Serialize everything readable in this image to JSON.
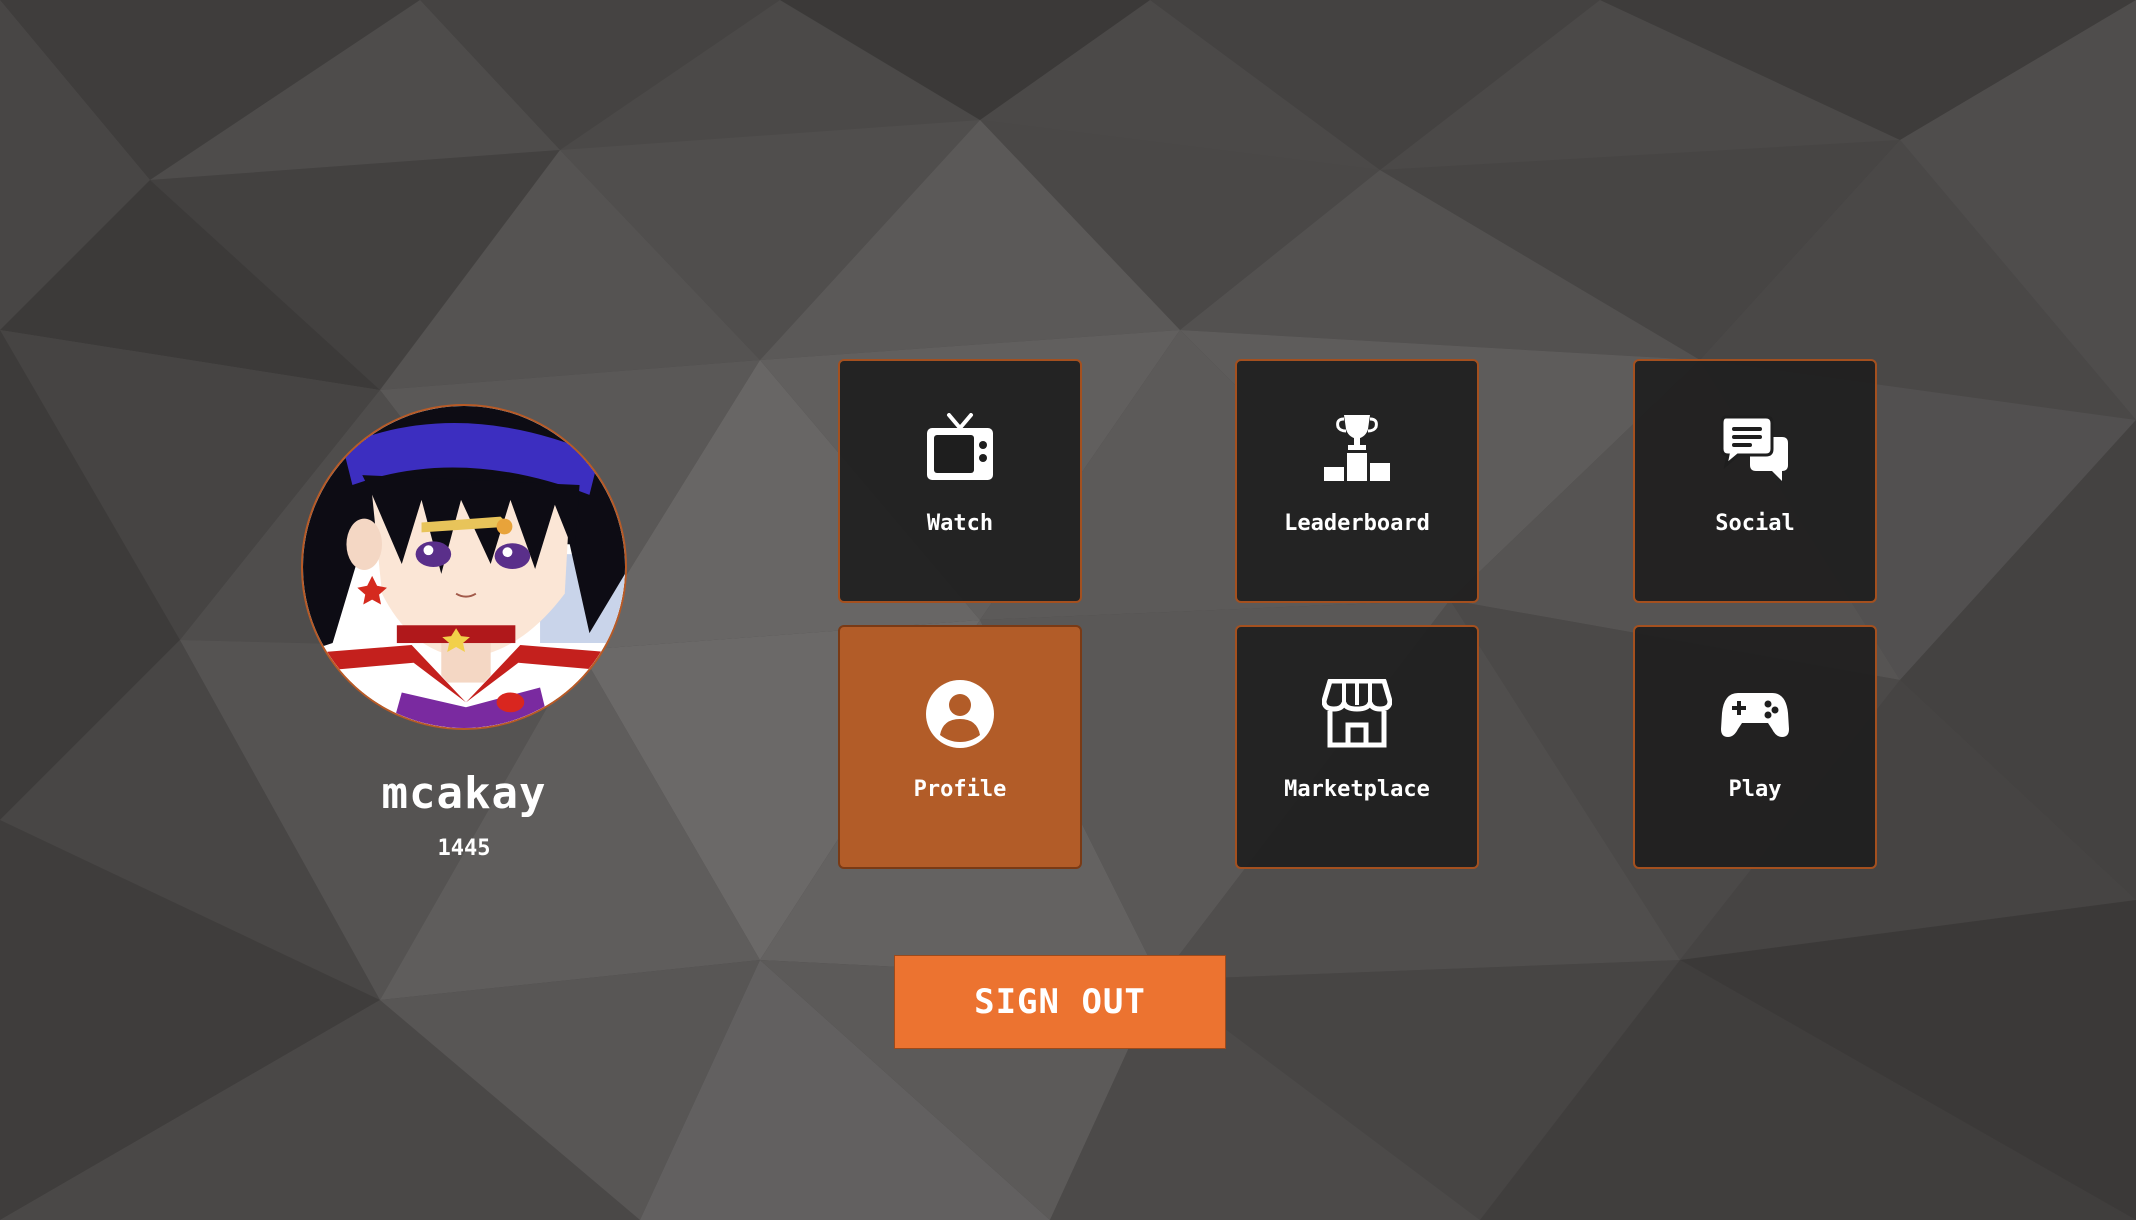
{
  "theme": {
    "accent": "#ec7330",
    "tile_border": "#a4501f",
    "active_tile": "#b25c28",
    "tile_bg": "#1e1e1e",
    "background": "#4a4847"
  },
  "profile": {
    "avatar_icon": "anime-character-avatar",
    "username": "mcakay",
    "score": "1445"
  },
  "menu": [
    {
      "label": "Watch",
      "icon": "tv-icon",
      "active": false
    },
    {
      "label": "Leaderboard",
      "icon": "podium-trophy-icon",
      "active": false
    },
    {
      "label": "Social",
      "icon": "chat-bubbles-icon",
      "active": false
    },
    {
      "label": "Profile",
      "icon": "user-circle-icon",
      "active": true
    },
    {
      "label": "Marketplace",
      "icon": "shop-icon",
      "active": false
    },
    {
      "label": "Play",
      "icon": "gamepad-icon",
      "active": false
    }
  ],
  "actions": {
    "sign_out_label": "SIGN OUT"
  }
}
